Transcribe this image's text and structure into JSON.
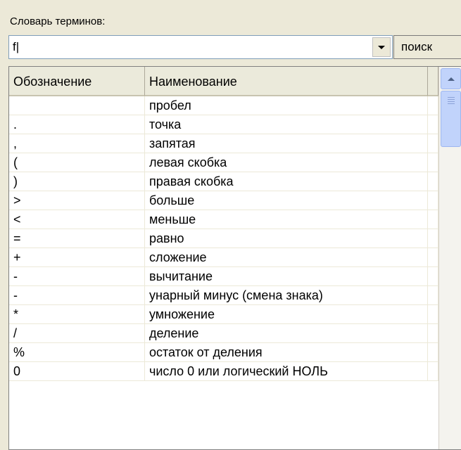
{
  "group_label": "Словарь терминов:",
  "search_field": {
    "value": "f|"
  },
  "search_button_label": "поиск",
  "table": {
    "columns": [
      "Обозначение",
      "Наименование"
    ],
    "rows": [
      {
        "symbol": "",
        "name": "пробел"
      },
      {
        "symbol": ".",
        "name": "точка"
      },
      {
        "symbol": ",",
        "name": "запятая"
      },
      {
        "symbol": "(",
        "name": "левая скобка"
      },
      {
        "symbol": ")",
        "name": "правая скобка"
      },
      {
        "symbol": ">",
        "name": "больше"
      },
      {
        "symbol": "<",
        "name": "меньше"
      },
      {
        "symbol": "=",
        "name": "равно"
      },
      {
        "symbol": "+",
        "name": "сложение"
      },
      {
        "symbol": "-",
        "name": "вычитание"
      },
      {
        "symbol": "-",
        "name": "унарный минус (смена знака)"
      },
      {
        "symbol": "*",
        "name": "умножение"
      },
      {
        "symbol": "/",
        "name": "деление"
      },
      {
        "symbol": "%",
        "name": "остаток от деления"
      },
      {
        "symbol": "0",
        "name": "число 0 или логический НОЛЬ"
      }
    ]
  }
}
